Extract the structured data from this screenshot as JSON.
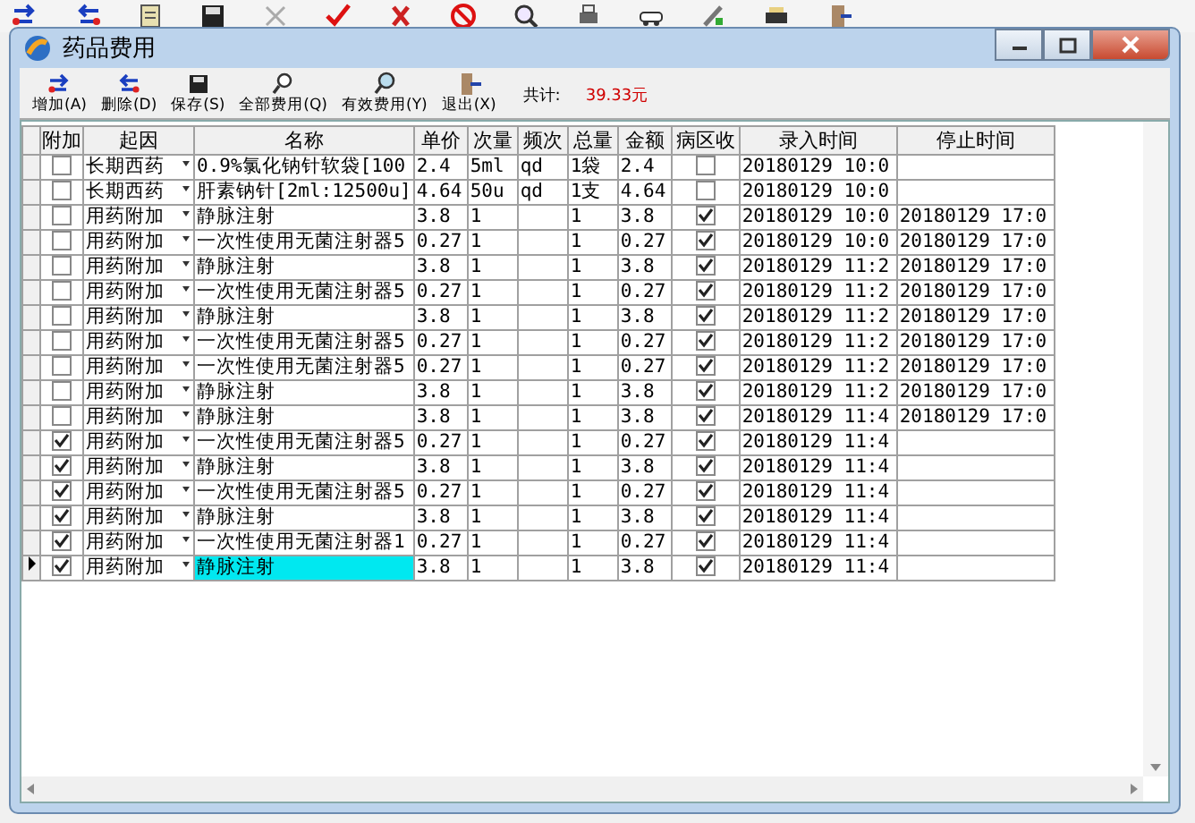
{
  "window": {
    "title": "药品费用"
  },
  "toolbar": [
    {
      "kind": "add",
      "label": "增加(A)"
    },
    {
      "kind": "delete",
      "label": "删除(D)"
    },
    {
      "kind": "save",
      "label": "保存(S)"
    },
    {
      "kind": "all",
      "label": "全部费用(Q)"
    },
    {
      "kind": "valid",
      "label": "有效费用(Y)"
    },
    {
      "kind": "exit",
      "label": "退出(X)"
    }
  ],
  "total": {
    "label": "共计:",
    "value": "39.33元"
  },
  "table": {
    "columns": [
      "附加",
      "起因",
      "名称",
      "单价",
      "次量",
      "频次",
      "总量",
      "金额",
      "病区收",
      "录入时间",
      "停止时间"
    ],
    "rows": [
      {
        "selected": false,
        "extra": false,
        "cause": "长期西药",
        "name": "0.9%氯化钠针软袋[100",
        "price": "2.4",
        "dose": "5ml",
        "freq": "qd",
        "qty": "1袋",
        "amount": "2.4",
        "ward": false,
        "entered": "20180129 10:0"
      },
      {
        "selected": false,
        "extra": false,
        "cause": "长期西药",
        "name": "肝素钠针[2ml:12500u]",
        "price": "4.64",
        "dose": "50u",
        "freq": "qd",
        "qty": "1支",
        "amount": "4.64",
        "ward": false,
        "entered": "20180129 10:0"
      },
      {
        "selected": false,
        "extra": false,
        "cause": "用药附加",
        "name": "静脉注射",
        "price": "3.8",
        "dose": "1",
        "qty": "1",
        "amount": "3.8",
        "ward": true,
        "entered": "20180129 10:0",
        "stopped": "20180129 17:0"
      },
      {
        "selected": false,
        "extra": false,
        "cause": "用药附加",
        "name": "一次性使用无菌注射器5",
        "price": "0.27",
        "dose": "1",
        "qty": "1",
        "amount": "0.27",
        "ward": true,
        "entered": "20180129 10:0",
        "stopped": "20180129 17:0"
      },
      {
        "selected": false,
        "extra": false,
        "cause": "用药附加",
        "name": "静脉注射",
        "price": "3.8",
        "dose": "1",
        "qty": "1",
        "amount": "3.8",
        "ward": true,
        "entered": "20180129 11:2",
        "stopped": "20180129 17:0"
      },
      {
        "selected": false,
        "extra": false,
        "cause": "用药附加",
        "name": "一次性使用无菌注射器5",
        "price": "0.27",
        "dose": "1",
        "qty": "1",
        "amount": "0.27",
        "ward": true,
        "entered": "20180129 11:2",
        "stopped": "20180129 17:0"
      },
      {
        "selected": false,
        "extra": false,
        "cause": "用药附加",
        "name": "静脉注射",
        "price": "3.8",
        "dose": "1",
        "qty": "1",
        "amount": "3.8",
        "ward": true,
        "entered": "20180129 11:2",
        "stopped": "20180129 17:0"
      },
      {
        "selected": false,
        "extra": false,
        "cause": "用药附加",
        "name": "一次性使用无菌注射器5",
        "price": "0.27",
        "dose": "1",
        "qty": "1",
        "amount": "0.27",
        "ward": true,
        "entered": "20180129 11:2",
        "stopped": "20180129 17:0"
      },
      {
        "selected": false,
        "extra": false,
        "cause": "用药附加",
        "name": "一次性使用无菌注射器5",
        "price": "0.27",
        "dose": "1",
        "qty": "1",
        "amount": "0.27",
        "ward": true,
        "entered": "20180129 11:2",
        "stopped": "20180129 17:0"
      },
      {
        "selected": false,
        "extra": false,
        "cause": "用药附加",
        "name": "静脉注射",
        "price": "3.8",
        "dose": "1",
        "qty": "1",
        "amount": "3.8",
        "ward": true,
        "entered": "20180129 11:2",
        "stopped": "20180129 17:0"
      },
      {
        "selected": false,
        "extra": false,
        "cause": "用药附加",
        "name": "静脉注射",
        "price": "3.8",
        "dose": "1",
        "qty": "1",
        "amount": "3.8",
        "ward": true,
        "entered": "20180129 11:4",
        "stopped": "20180129 17:0"
      },
      {
        "selected": false,
        "extra": true,
        "cause": "用药附加",
        "name": "一次性使用无菌注射器5",
        "price": "0.27",
        "dose": "1",
        "qty": "1",
        "amount": "0.27",
        "ward": true,
        "entered": "20180129 11:4"
      },
      {
        "selected": false,
        "extra": true,
        "cause": "用药附加",
        "name": "静脉注射",
        "price": "3.8",
        "dose": "1",
        "qty": "1",
        "amount": "3.8",
        "ward": true,
        "entered": "20180129 11:4"
      },
      {
        "selected": false,
        "extra": true,
        "cause": "用药附加",
        "name": "一次性使用无菌注射器5",
        "price": "0.27",
        "dose": "1",
        "qty": "1",
        "amount": "0.27",
        "ward": true,
        "entered": "20180129 11:4"
      },
      {
        "selected": false,
        "extra": true,
        "cause": "用药附加",
        "name": "静脉注射",
        "price": "3.8",
        "dose": "1",
        "qty": "1",
        "amount": "3.8",
        "ward": true,
        "entered": "20180129 11:4"
      },
      {
        "selected": false,
        "extra": true,
        "cause": "用药附加",
        "name": "一次性使用无菌注射器1",
        "price": "0.27",
        "dose": "1",
        "qty": "1",
        "amount": "0.27",
        "ward": true,
        "entered": "20180129 11:4"
      },
      {
        "selected": true,
        "extra": true,
        "cause": "用药附加",
        "name": "静脉注射",
        "price": "3.8",
        "dose": "1",
        "qty": "1",
        "amount": "3.8",
        "ward": true,
        "entered": "20180129 11:4"
      }
    ]
  }
}
